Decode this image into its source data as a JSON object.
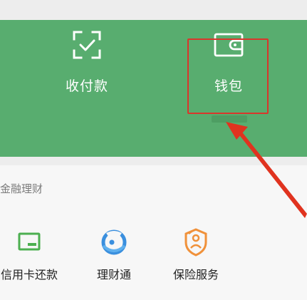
{
  "panel": {
    "pay_label": "收付款",
    "wallet_label": "钱包"
  },
  "finance": {
    "section_title": "金融理财",
    "items": [
      {
        "label": "信用卡还款",
        "icon": "credit-card-repay-icon"
      },
      {
        "label": "理财通",
        "icon": "licaitong-icon"
      },
      {
        "label": "保险服务",
        "icon": "insurance-service-icon"
      }
    ]
  },
  "colors": {
    "panel_green": "#58ad6f",
    "highlight_red": "#d9362b",
    "licai_blue": "#3a8fde",
    "insure_orange": "#f0913a",
    "credit_green": "#4caf50"
  }
}
